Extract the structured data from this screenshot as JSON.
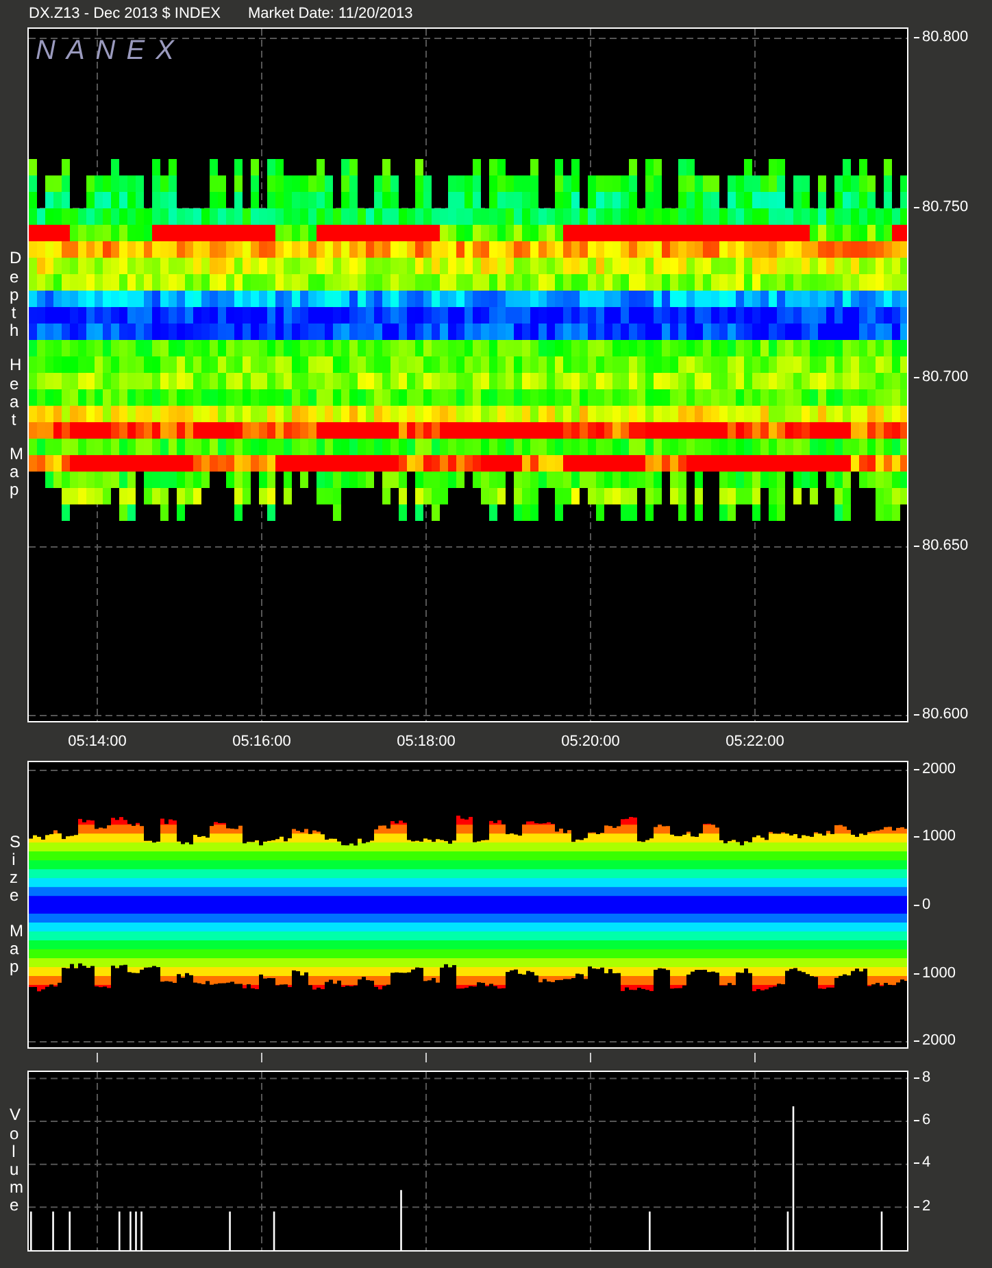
{
  "header": {
    "symbol": "DX.Z13 - Dec 2013 $ INDEX",
    "market_date": "Market Date: 11/20/2013"
  },
  "heat_map": {
    "logo": "NANEX",
    "side_label": "Depth Heat Map",
    "price_labels": [
      "80.800",
      "80.750",
      "80.700",
      "80.650",
      "80.600"
    ]
  },
  "time_labels": [
    "05:14:00",
    "05:16:00",
    "05:18:00",
    "05:20:00",
    "05:22:00"
  ],
  "size_map": {
    "side_label": "Size Map",
    "size_labels": [
      "2000",
      "1000",
      "0",
      "1000",
      "2000"
    ]
  },
  "volume": {
    "side_label": "Volume",
    "chart_data": {
      "type": "bar",
      "grid": true,
      "ylim": [
        0,
        8.3
      ],
      "yticks": [
        8,
        6,
        4,
        2
      ],
      "values": [
        1.8,
        null,
        null,
        null,
        1.8,
        null,
        null,
        1.8,
        null,
        null,
        null,
        null,
        null,
        null,
        null,
        null,
        1.8,
        null,
        1.8,
        1.8,
        1.8,
        null,
        null,
        null,
        null,
        null,
        null,
        null,
        null,
        null,
        null,
        null,
        null,
        null,
        null,
        null,
        1.8,
        null,
        null,
        null,
        null,
        null,
        null,
        null,
        1.8,
        null,
        null,
        null,
        null,
        null,
        null,
        null,
        null,
        null,
        null,
        null,
        null,
        null,
        null,
        null,
        null,
        null,
        null,
        null,
        null,
        null,
        null,
        2.8,
        null,
        null,
        null,
        null,
        null,
        null,
        null,
        null,
        null,
        null,
        null,
        null,
        null,
        null,
        null,
        null,
        null,
        null,
        null,
        null,
        null,
        null,
        null,
        null,
        null,
        null,
        null,
        null,
        null,
        null,
        null,
        null,
        null,
        null,
        null,
        null,
        null,
        null,
        null,
        null,
        null,
        null,
        null,
        null,
        1.8,
        null,
        null,
        null,
        null,
        null,
        null,
        null,
        null,
        null,
        null,
        null,
        null,
        null,
        null,
        null,
        null,
        null,
        null,
        null,
        null,
        null,
        null,
        null,
        null,
        1.8,
        6.7,
        null,
        null,
        null,
        null,
        null,
        null,
        null,
        null,
        null,
        null,
        null,
        null,
        null,
        null,
        null,
        1.8,
        null,
        null,
        null,
        null
      ]
    }
  }
}
